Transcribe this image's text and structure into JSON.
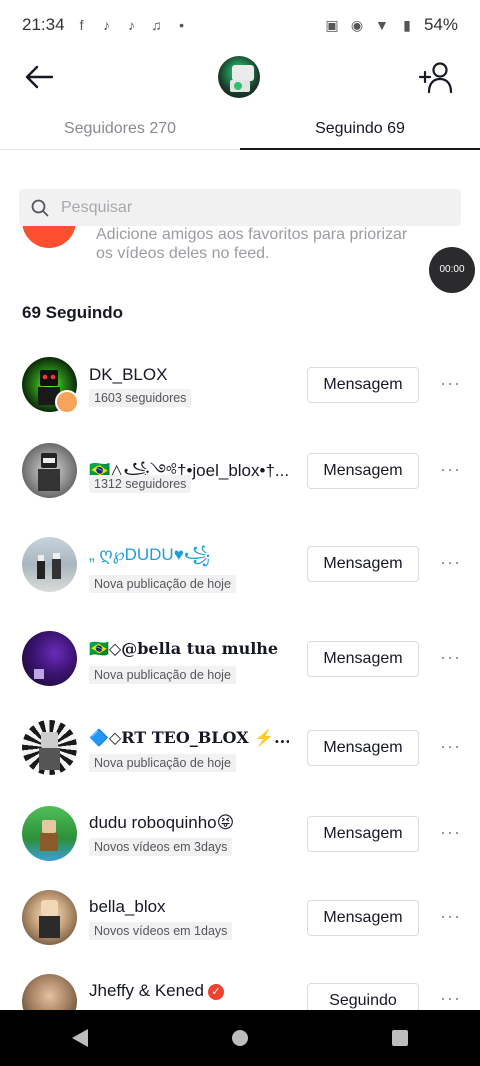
{
  "status": {
    "time": "21:34",
    "battery": "54%"
  },
  "tabs": [
    {
      "label": "Seguidores 270"
    },
    {
      "label": "Seguindo 69"
    }
  ],
  "search": {
    "placeholder": "Pesquisar"
  },
  "promo": {
    "text": "Adicione amigos aos favoritos para priorizar os vídeos deles no feed."
  },
  "timer": "00:00",
  "following_count": "69 Seguindo",
  "rows": [
    {
      "name": "DK_BLOX",
      "sub": "1603 seguidores",
      "button": "Mensagem"
    },
    {
      "name": "🇧🇷△꧁༺†•joel_blox•†...",
      "sub": "1312 seguidores",
      "button": "Mensagem"
    },
    {
      "name": "„ ღ℘DUDU♥꧁",
      "sub": "Nova publicação de hoje",
      "button": "Mensagem"
    },
    {
      "name": "🇧🇷◇@bella tua mulhe",
      "sub": "Nova publicação de hoje",
      "button": "Mensagem"
    },
    {
      "name": "🔷◇RT TEO_BLOX ⚡...",
      "sub": "Nova publicação de hoje",
      "button": "Mensagem"
    },
    {
      "name": "dudu roboquinho😝",
      "sub": "Novos vídeos em 3days",
      "button": "Mensagem"
    },
    {
      "name": "bella_blox",
      "sub": "Novos vídeos em 1days",
      "button": "Mensagem"
    },
    {
      "name": "Jheffy & Kened",
      "sub": "",
      "button": "Seguindo"
    }
  ],
  "more_label": "···",
  "colors": {
    "accent": "#fe2c55",
    "promo": "#fe5030",
    "text": "#161823"
  }
}
